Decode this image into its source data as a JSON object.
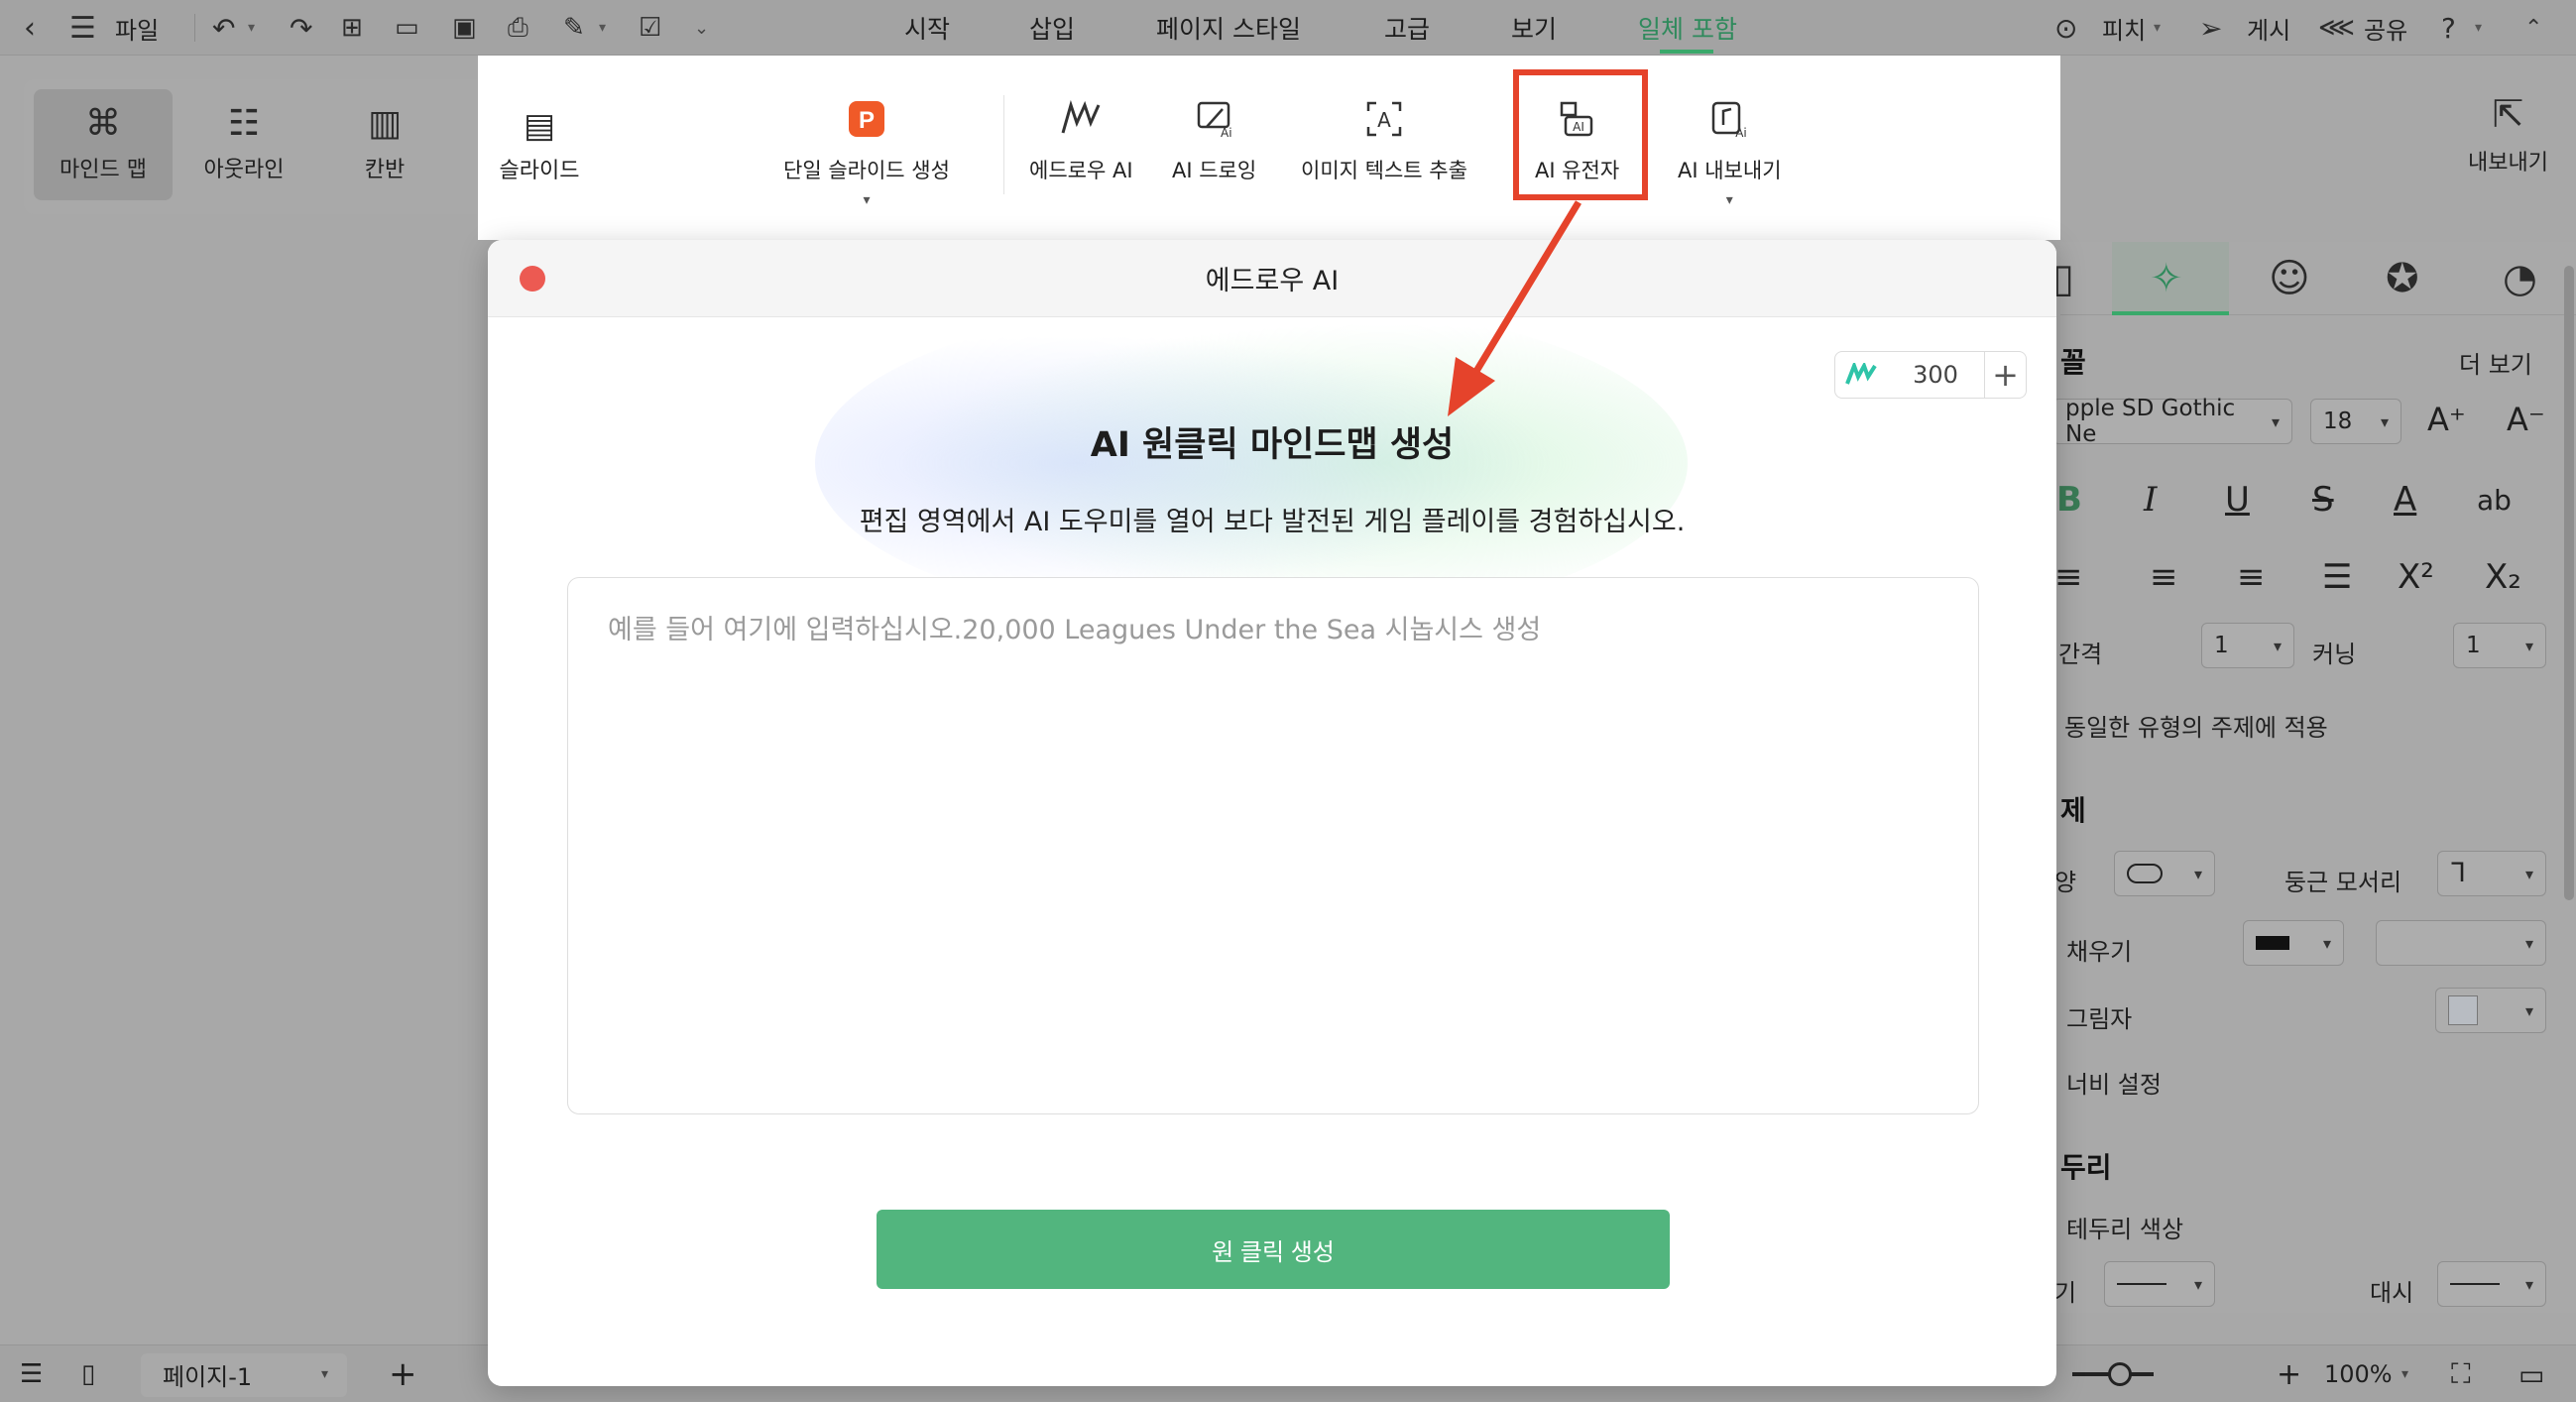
{
  "topbar": {
    "file_label": "파일",
    "menus": [
      "시작",
      "삽입",
      "페이지 스타일",
      "고급",
      "보기",
      "일체 포함"
    ],
    "active_menu_index": 5,
    "pitch_label": "피치",
    "publish_label": "게시",
    "share_label": "공유"
  },
  "views": {
    "items": [
      "마인드 맵",
      "아웃라인",
      "칸반",
      "슬라이드"
    ],
    "selected_index": 0
  },
  "ribbon": {
    "items": [
      "단일 슬라이드 생성",
      "에드로우 AI",
      "AI 드로잉",
      "이미지 텍스트 추출",
      "AI 유전자",
      "AI 내보내기"
    ],
    "highlighted_index": 4,
    "export_label": "내보내기"
  },
  "dialog": {
    "title": "에드로우 AI",
    "credits": "300",
    "heading": "AI 원클릭 마인드맵 생성",
    "subtitle": "편집 영역에서 AI 도우미를 열어 보다 발전된 게임 플레이를 경험하십시오.",
    "placeholder": "예를 들어 여기에 입력하십시오.20,000 Leagues Under the Sea 시놉시스 생성",
    "generate_label": "원 클릭 생성"
  },
  "right_panel": {
    "font_section_suffix": "꼴",
    "more_label": "더 보기",
    "font_name": "pple SD Gothic Ne",
    "font_size": "18",
    "spacing_label": "간격",
    "spacing_value": "1",
    "kerning_label": "커닝",
    "kerning_value": "1",
    "apply_same_label": "동일한 유형의 주제에 적용",
    "theme_head": "제",
    "shape_label": "양",
    "rounded_label": "둥근 모서리",
    "fill_label": "채우기",
    "shadow_label": "그림자",
    "width_label": "너비 설정",
    "border_head": "두리",
    "border_color_label": "테두리 색상",
    "thickness_label": "기",
    "dash_label": "대시"
  },
  "bottombar": {
    "page_name": "페이지-1",
    "zoom": "100%"
  },
  "colors": {
    "accent_green": "#52b57e",
    "highlight_red": "#e5432b",
    "close_red": "#ec5a52"
  }
}
